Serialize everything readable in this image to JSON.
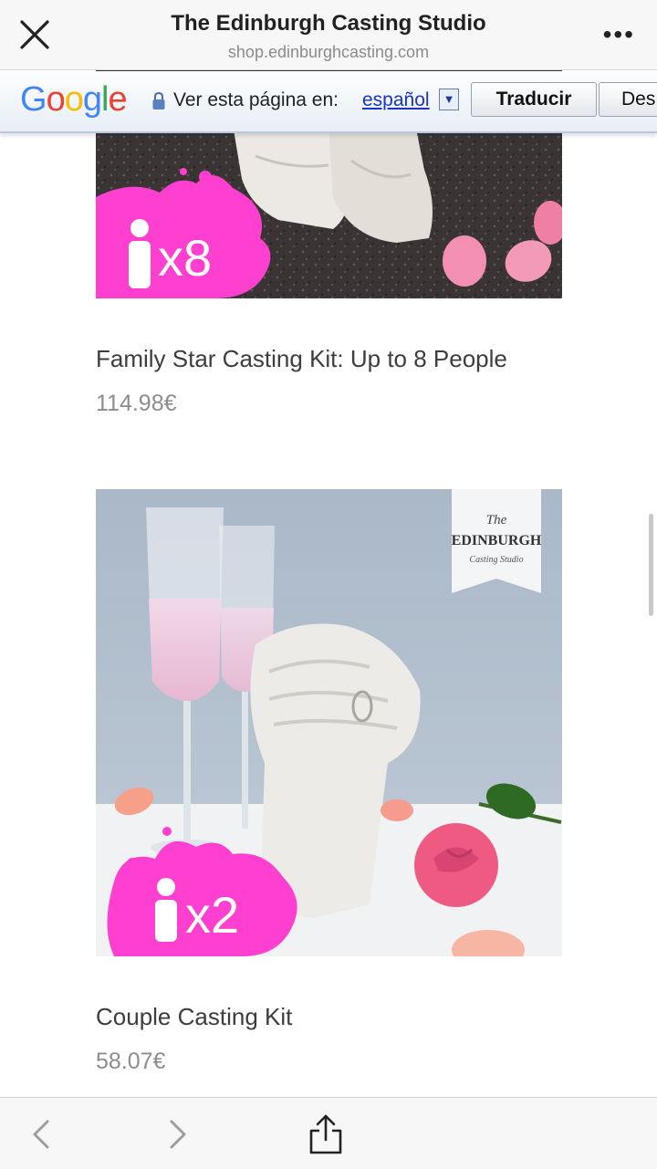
{
  "header": {
    "title": "The Edinburgh Casting Studio",
    "url": "shop.edinburghcasting.com",
    "more": "•••"
  },
  "translate_bar": {
    "logo": "Google",
    "prompt": "Ver esta página en:",
    "language": "español",
    "dropdown_glyph": "▼",
    "translate_button": "Traducir",
    "other_button": "Des"
  },
  "products": [
    {
      "name": "Family Star Casting Kit: Up to 8 People",
      "price": "114.98€",
      "badge": "x8"
    },
    {
      "name": "Couple Casting Kit",
      "price": "58.07€",
      "badge": "x2",
      "logo": {
        "line1": "The",
        "line2": "EDINBURGH",
        "line3": "Casting Studio"
      }
    }
  ],
  "colors": {
    "accent_pink": "#ff3fd0",
    "link_blue": "#1a33c9",
    "google_blue": "#4285f4",
    "google_red": "#ea4335",
    "google_yellow": "#fbbc05",
    "google_green": "#34a853"
  },
  "icons": {
    "close": "close-icon",
    "more": "more-icon",
    "back": "chevron-left-icon",
    "forward": "chevron-right-icon",
    "share": "share-icon",
    "lock": "lock-icon",
    "person": "person-icon"
  }
}
